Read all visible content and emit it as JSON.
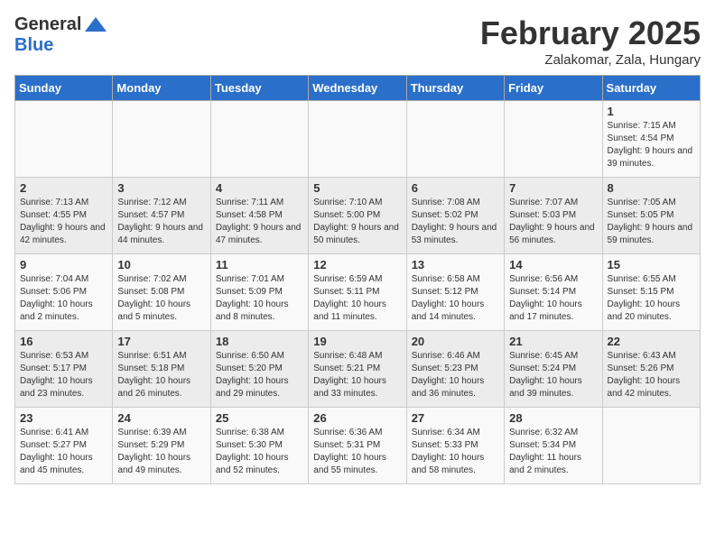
{
  "logo": {
    "text_general": "General",
    "text_blue": "Blue"
  },
  "title": "February 2025",
  "subtitle": "Zalakomar, Zala, Hungary",
  "weekdays": [
    "Sunday",
    "Monday",
    "Tuesday",
    "Wednesday",
    "Thursday",
    "Friday",
    "Saturday"
  ],
  "weeks": [
    [
      {
        "day": "",
        "info": ""
      },
      {
        "day": "",
        "info": ""
      },
      {
        "day": "",
        "info": ""
      },
      {
        "day": "",
        "info": ""
      },
      {
        "day": "",
        "info": ""
      },
      {
        "day": "",
        "info": ""
      },
      {
        "day": "1",
        "info": "Sunrise: 7:15 AM\nSunset: 4:54 PM\nDaylight: 9 hours and 39 minutes."
      }
    ],
    [
      {
        "day": "2",
        "info": "Sunrise: 7:13 AM\nSunset: 4:55 PM\nDaylight: 9 hours and 42 minutes."
      },
      {
        "day": "3",
        "info": "Sunrise: 7:12 AM\nSunset: 4:57 PM\nDaylight: 9 hours and 44 minutes."
      },
      {
        "day": "4",
        "info": "Sunrise: 7:11 AM\nSunset: 4:58 PM\nDaylight: 9 hours and 47 minutes."
      },
      {
        "day": "5",
        "info": "Sunrise: 7:10 AM\nSunset: 5:00 PM\nDaylight: 9 hours and 50 minutes."
      },
      {
        "day": "6",
        "info": "Sunrise: 7:08 AM\nSunset: 5:02 PM\nDaylight: 9 hours and 53 minutes."
      },
      {
        "day": "7",
        "info": "Sunrise: 7:07 AM\nSunset: 5:03 PM\nDaylight: 9 hours and 56 minutes."
      },
      {
        "day": "8",
        "info": "Sunrise: 7:05 AM\nSunset: 5:05 PM\nDaylight: 9 hours and 59 minutes."
      }
    ],
    [
      {
        "day": "9",
        "info": "Sunrise: 7:04 AM\nSunset: 5:06 PM\nDaylight: 10 hours and 2 minutes."
      },
      {
        "day": "10",
        "info": "Sunrise: 7:02 AM\nSunset: 5:08 PM\nDaylight: 10 hours and 5 minutes."
      },
      {
        "day": "11",
        "info": "Sunrise: 7:01 AM\nSunset: 5:09 PM\nDaylight: 10 hours and 8 minutes."
      },
      {
        "day": "12",
        "info": "Sunrise: 6:59 AM\nSunset: 5:11 PM\nDaylight: 10 hours and 11 minutes."
      },
      {
        "day": "13",
        "info": "Sunrise: 6:58 AM\nSunset: 5:12 PM\nDaylight: 10 hours and 14 minutes."
      },
      {
        "day": "14",
        "info": "Sunrise: 6:56 AM\nSunset: 5:14 PM\nDaylight: 10 hours and 17 minutes."
      },
      {
        "day": "15",
        "info": "Sunrise: 6:55 AM\nSunset: 5:15 PM\nDaylight: 10 hours and 20 minutes."
      }
    ],
    [
      {
        "day": "16",
        "info": "Sunrise: 6:53 AM\nSunset: 5:17 PM\nDaylight: 10 hours and 23 minutes."
      },
      {
        "day": "17",
        "info": "Sunrise: 6:51 AM\nSunset: 5:18 PM\nDaylight: 10 hours and 26 minutes."
      },
      {
        "day": "18",
        "info": "Sunrise: 6:50 AM\nSunset: 5:20 PM\nDaylight: 10 hours and 29 minutes."
      },
      {
        "day": "19",
        "info": "Sunrise: 6:48 AM\nSunset: 5:21 PM\nDaylight: 10 hours and 33 minutes."
      },
      {
        "day": "20",
        "info": "Sunrise: 6:46 AM\nSunset: 5:23 PM\nDaylight: 10 hours and 36 minutes."
      },
      {
        "day": "21",
        "info": "Sunrise: 6:45 AM\nSunset: 5:24 PM\nDaylight: 10 hours and 39 minutes."
      },
      {
        "day": "22",
        "info": "Sunrise: 6:43 AM\nSunset: 5:26 PM\nDaylight: 10 hours and 42 minutes."
      }
    ],
    [
      {
        "day": "23",
        "info": "Sunrise: 6:41 AM\nSunset: 5:27 PM\nDaylight: 10 hours and 45 minutes."
      },
      {
        "day": "24",
        "info": "Sunrise: 6:39 AM\nSunset: 5:29 PM\nDaylight: 10 hours and 49 minutes."
      },
      {
        "day": "25",
        "info": "Sunrise: 6:38 AM\nSunset: 5:30 PM\nDaylight: 10 hours and 52 minutes."
      },
      {
        "day": "26",
        "info": "Sunrise: 6:36 AM\nSunset: 5:31 PM\nDaylight: 10 hours and 55 minutes."
      },
      {
        "day": "27",
        "info": "Sunrise: 6:34 AM\nSunset: 5:33 PM\nDaylight: 10 hours and 58 minutes."
      },
      {
        "day": "28",
        "info": "Sunrise: 6:32 AM\nSunset: 5:34 PM\nDaylight: 11 hours and 2 minutes."
      },
      {
        "day": "",
        "info": ""
      }
    ]
  ]
}
